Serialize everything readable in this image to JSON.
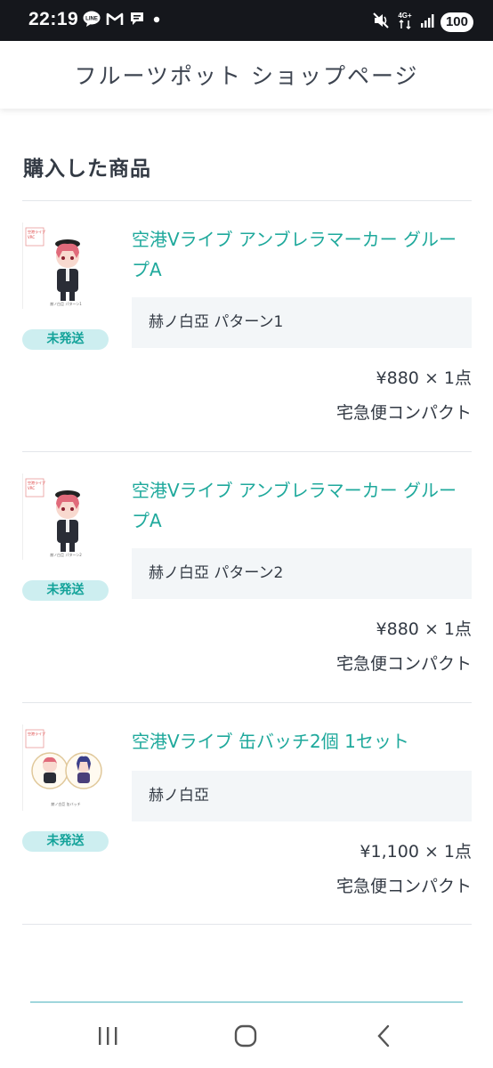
{
  "status_bar": {
    "time": "22:19",
    "left_icons": [
      "line-icon",
      "gmail-icon",
      "chat-bubble-icon",
      "dot-icon"
    ],
    "network": "4G+",
    "battery": "100"
  },
  "header": {
    "title": "フルーツポット ショップページ"
  },
  "section": {
    "title": "購入した商品"
  },
  "orders": [
    {
      "name": "空港Vライブ アンブレラマーカー グループA",
      "variant": "赫ノ白亞 パターン1",
      "price": "¥880 × 1点",
      "shipping": "宅急便コンパクト",
      "status": "未発送"
    },
    {
      "name": "空港Vライブ アンブレラマーカー グループA",
      "variant": "赫ノ白亞 パターン2",
      "price": "¥880 × 1点",
      "shipping": "宅急便コンパクト",
      "status": "未発送"
    },
    {
      "name": "空港Vライブ 缶バッチ2個 1セット",
      "variant": "赫ノ白亞",
      "price": "¥1,100 × 1点",
      "shipping": "宅急便コンパクト",
      "status": "未発送"
    }
  ],
  "nav": {
    "icons": [
      "recents-icon",
      "home-icon",
      "back-icon"
    ]
  },
  "colors": {
    "accent": "#1fa99c",
    "badge_bg": "#cdeef0",
    "variant_bg": "#f3f6f8",
    "statusbar": "#15171c"
  }
}
